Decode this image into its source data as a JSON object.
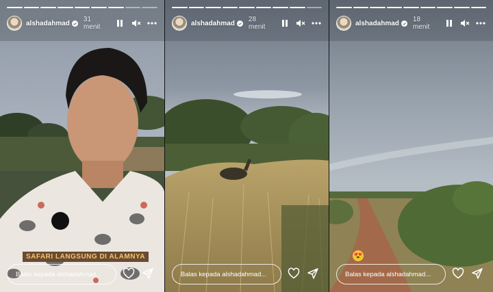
{
  "stories": [
    {
      "username": "alshadahmad",
      "time": "31 menit",
      "reply_placeholder": "Balas kepada alshadahmad...",
      "caption": "SAFARI LANGSUNG DI ALAMNYA",
      "progress_done": 7,
      "progress_total": 9
    },
    {
      "username": "alshadahmad",
      "time": "28 menit",
      "reply_placeholder": "Balas kepada alshadahmad...",
      "progress_done": 8,
      "progress_total": 9
    },
    {
      "username": "alshadahmad",
      "time": "18 menit",
      "reply_placeholder": "Balas kepada alshadahmad...",
      "emoji": "😍",
      "progress_done": 9,
      "progress_total": 9
    }
  ],
  "icons": {
    "pause": "pause-icon",
    "mute": "speaker-muted-icon",
    "more": "more-dots-icon",
    "like": "heart-icon",
    "share": "send-icon",
    "verified": "verified-badge-icon"
  }
}
